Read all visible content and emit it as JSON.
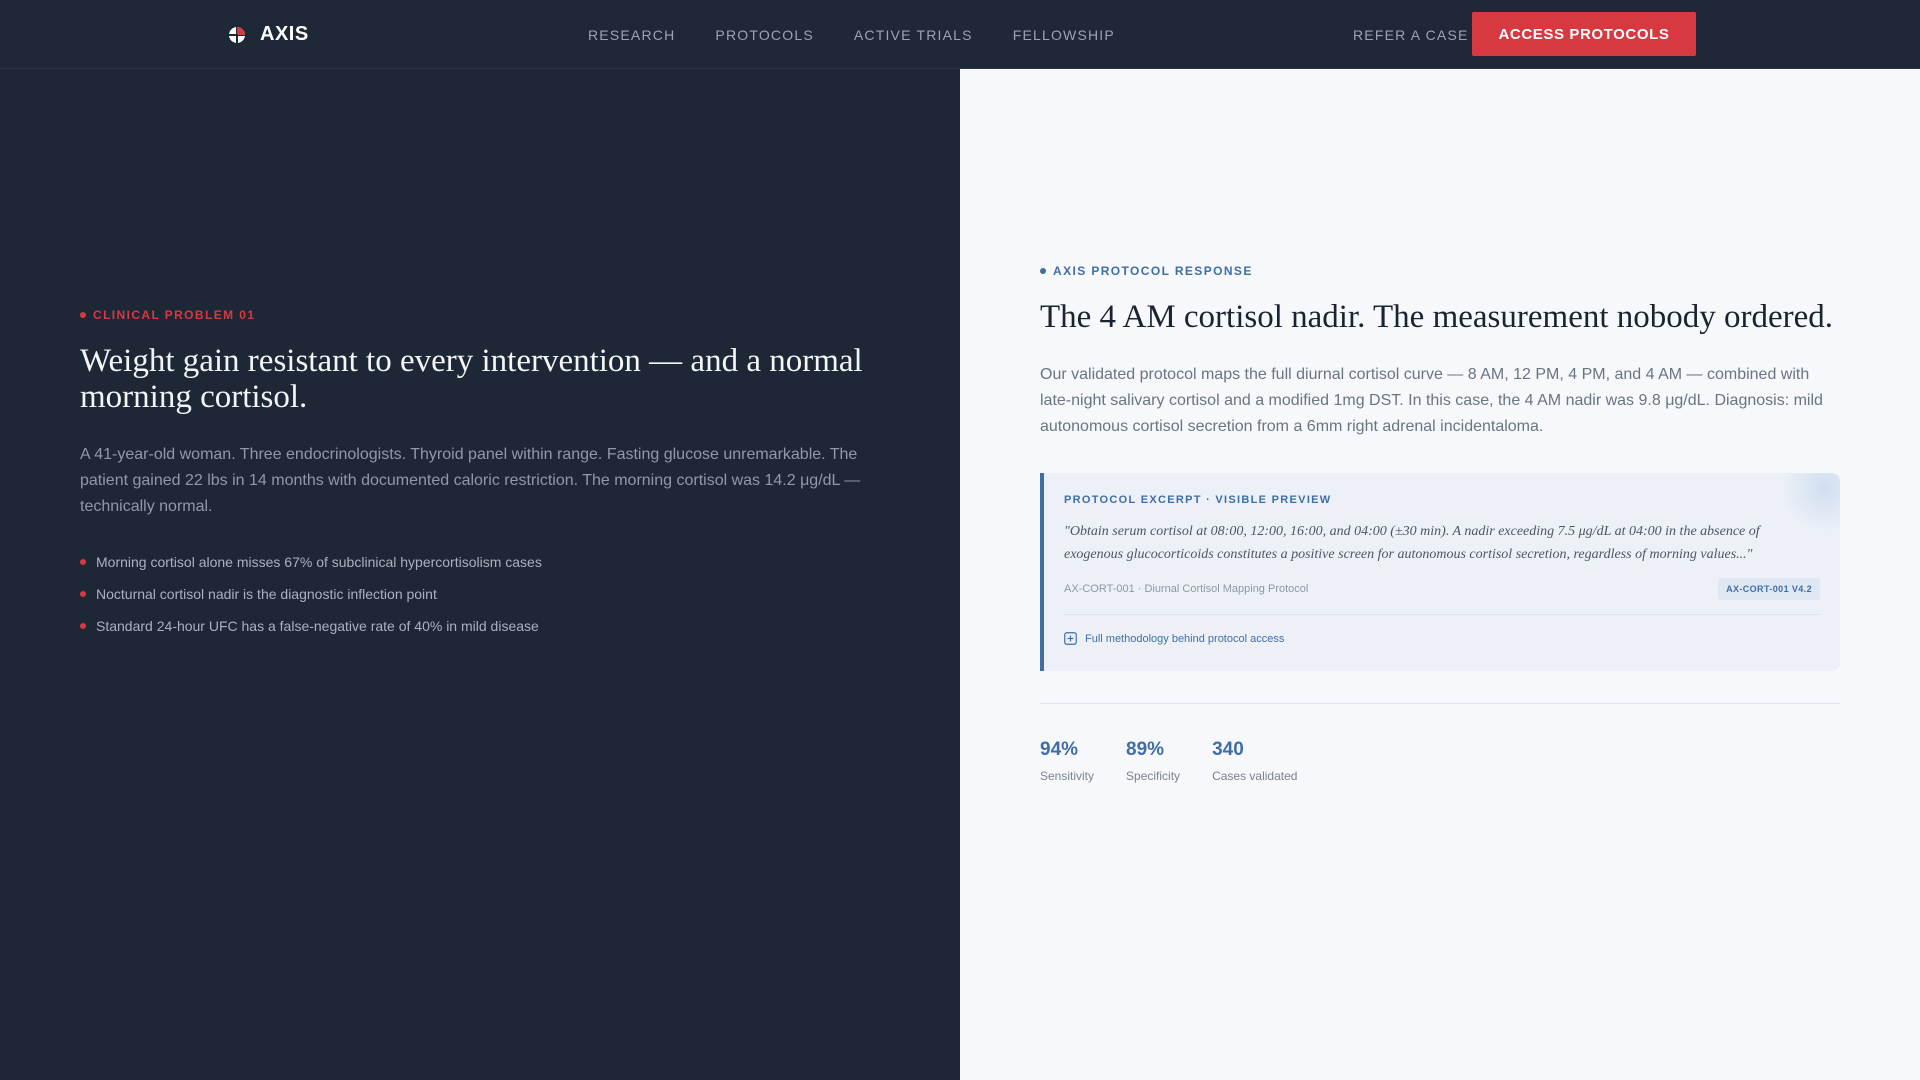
{
  "header": {
    "logo_text": "AXIS",
    "nav": [
      "RESEARCH",
      "PROTOCOLS",
      "ACTIVE TRIALS",
      "FELLOWSHIP"
    ],
    "refer_label": "REFER A CASE",
    "cta_label": "ACCESS PROTOCOLS"
  },
  "problem": {
    "eyebrow": "CLINICAL PROBLEM 01",
    "title": "Weight gain resistant to every intervention — and a normal morning cortisol.",
    "body": "A 41-year-old woman. Three endocrinologists. Thyroid panel within range. Fasting glucose unremarkable. The patient gained 22 lbs in 14 months with documented caloric restriction. The morning cortisol was 14.2 μg/dL — technically normal.",
    "bullets": [
      "Morning cortisol alone misses 67% of subclinical hypercortisolism cases",
      "Nocturnal cortisol nadir is the diagnostic inflection point",
      "Standard 24-hour UFC has a false-negative rate of 40% in mild disease"
    ]
  },
  "response": {
    "eyebrow": "AXIS PROTOCOL RESPONSE",
    "title": "The 4 AM cortisol nadir. The measurement nobody ordered.",
    "body": "Our validated protocol maps the full diurnal cortisol curve — 8 AM, 12 PM, 4 PM, and 4 AM — combined with late-night salivary cortisol and a modified 1mg DST. In this case, the 4 AM nadir was 9.8 μg/dL. Diagnosis: mild autonomous cortisol secretion from a 6mm right adrenal incidentaloma.",
    "excerpt": {
      "label": "PROTOCOL EXCERPT · VISIBLE PREVIEW",
      "quote": "\"Obtain serum cortisol at 08:00, 12:00, 16:00, and 04:00 (±30 min). A nadir exceeding 7.5 μg/dL at 04:00 in the absence of exogenous glucocorticoids constitutes a positive screen for autonomous cortisol secretion, regardless of morning values...\"",
      "ref": "AX-CORT-001 · Diurnal Cortisol Mapping Protocol",
      "badge": "AX-CORT-001 V4.2",
      "link": "Full methodology behind protocol access"
    },
    "stats": [
      {
        "value": "94%",
        "label": "Sensitivity"
      },
      {
        "value": "89%",
        "label": "Specificity"
      },
      {
        "value": "340",
        "label": "Cases validated"
      }
    ]
  },
  "colors": {
    "accent_red": "#d8383f",
    "accent_blue": "#3f6ea6",
    "dark_bg": "#1e2736",
    "light_bg": "#f6f8fb"
  },
  "icons": {
    "logo": "axis-logo-icon",
    "link": "plus-square-icon"
  }
}
